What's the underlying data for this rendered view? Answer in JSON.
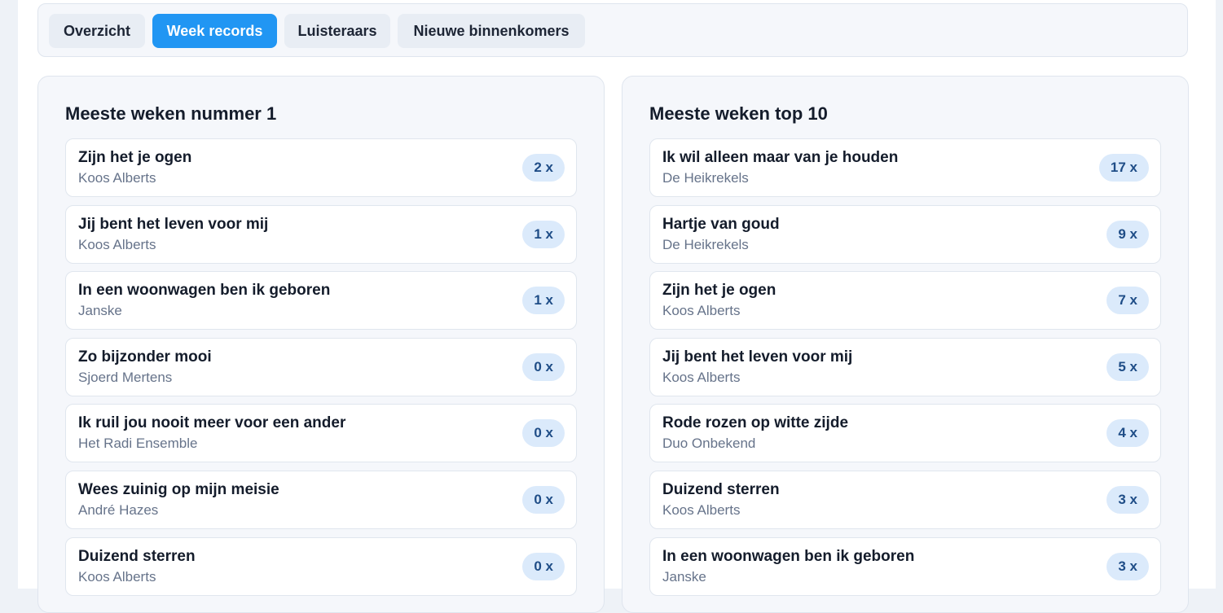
{
  "tabs": [
    {
      "label": "Overzicht",
      "active": false
    },
    {
      "label": "Week records",
      "active": true
    },
    {
      "label": "Luisteraars",
      "active": false
    },
    {
      "label": "Nieuwe binnenkomers",
      "active": false
    }
  ],
  "left_panel": {
    "title": "Meeste weken nummer 1",
    "items": [
      {
        "title": "Zijn het je ogen",
        "artist": "Koos Alberts",
        "count": "2 x"
      },
      {
        "title": "Jij bent het leven voor mij",
        "artist": "Koos Alberts",
        "count": "1 x"
      },
      {
        "title": "In een woonwagen ben ik geboren",
        "artist": "Janske",
        "count": "1 x"
      },
      {
        "title": "Zo bijzonder mooi",
        "artist": "Sjoerd Mertens",
        "count": "0 x"
      },
      {
        "title": "Ik ruil jou nooit meer voor een ander",
        "artist": "Het Radi Ensemble",
        "count": "0 x"
      },
      {
        "title": "Wees zuinig op mijn meisie",
        "artist": "André Hazes",
        "count": "0 x"
      },
      {
        "title": "Duizend sterren",
        "artist": "Koos Alberts",
        "count": "0 x"
      }
    ]
  },
  "right_panel": {
    "title": "Meeste weken top 10",
    "items": [
      {
        "title": "Ik wil alleen maar van je houden",
        "artist": "De Heikrekels",
        "count": "17 x"
      },
      {
        "title": "Hartje van goud",
        "artist": "De Heikrekels",
        "count": "9 x"
      },
      {
        "title": "Zijn het je ogen",
        "artist": "Koos Alberts",
        "count": "7 x"
      },
      {
        "title": "Jij bent het leven voor mij",
        "artist": "Koos Alberts",
        "count": "5 x"
      },
      {
        "title": "Rode rozen op witte zijde",
        "artist": "Duo Onbekend",
        "count": "4 x"
      },
      {
        "title": "Duizend sterren",
        "artist": "Koos Alberts",
        "count": "3 x"
      },
      {
        "title": "In een woonwagen ben ik geboren",
        "artist": "Janske",
        "count": "3 x"
      }
    ]
  },
  "colors": {
    "accent": "#2196f3",
    "badge_bg": "#dbeafb",
    "badge_text": "#1f4d87",
    "muted_text": "#66738a"
  }
}
